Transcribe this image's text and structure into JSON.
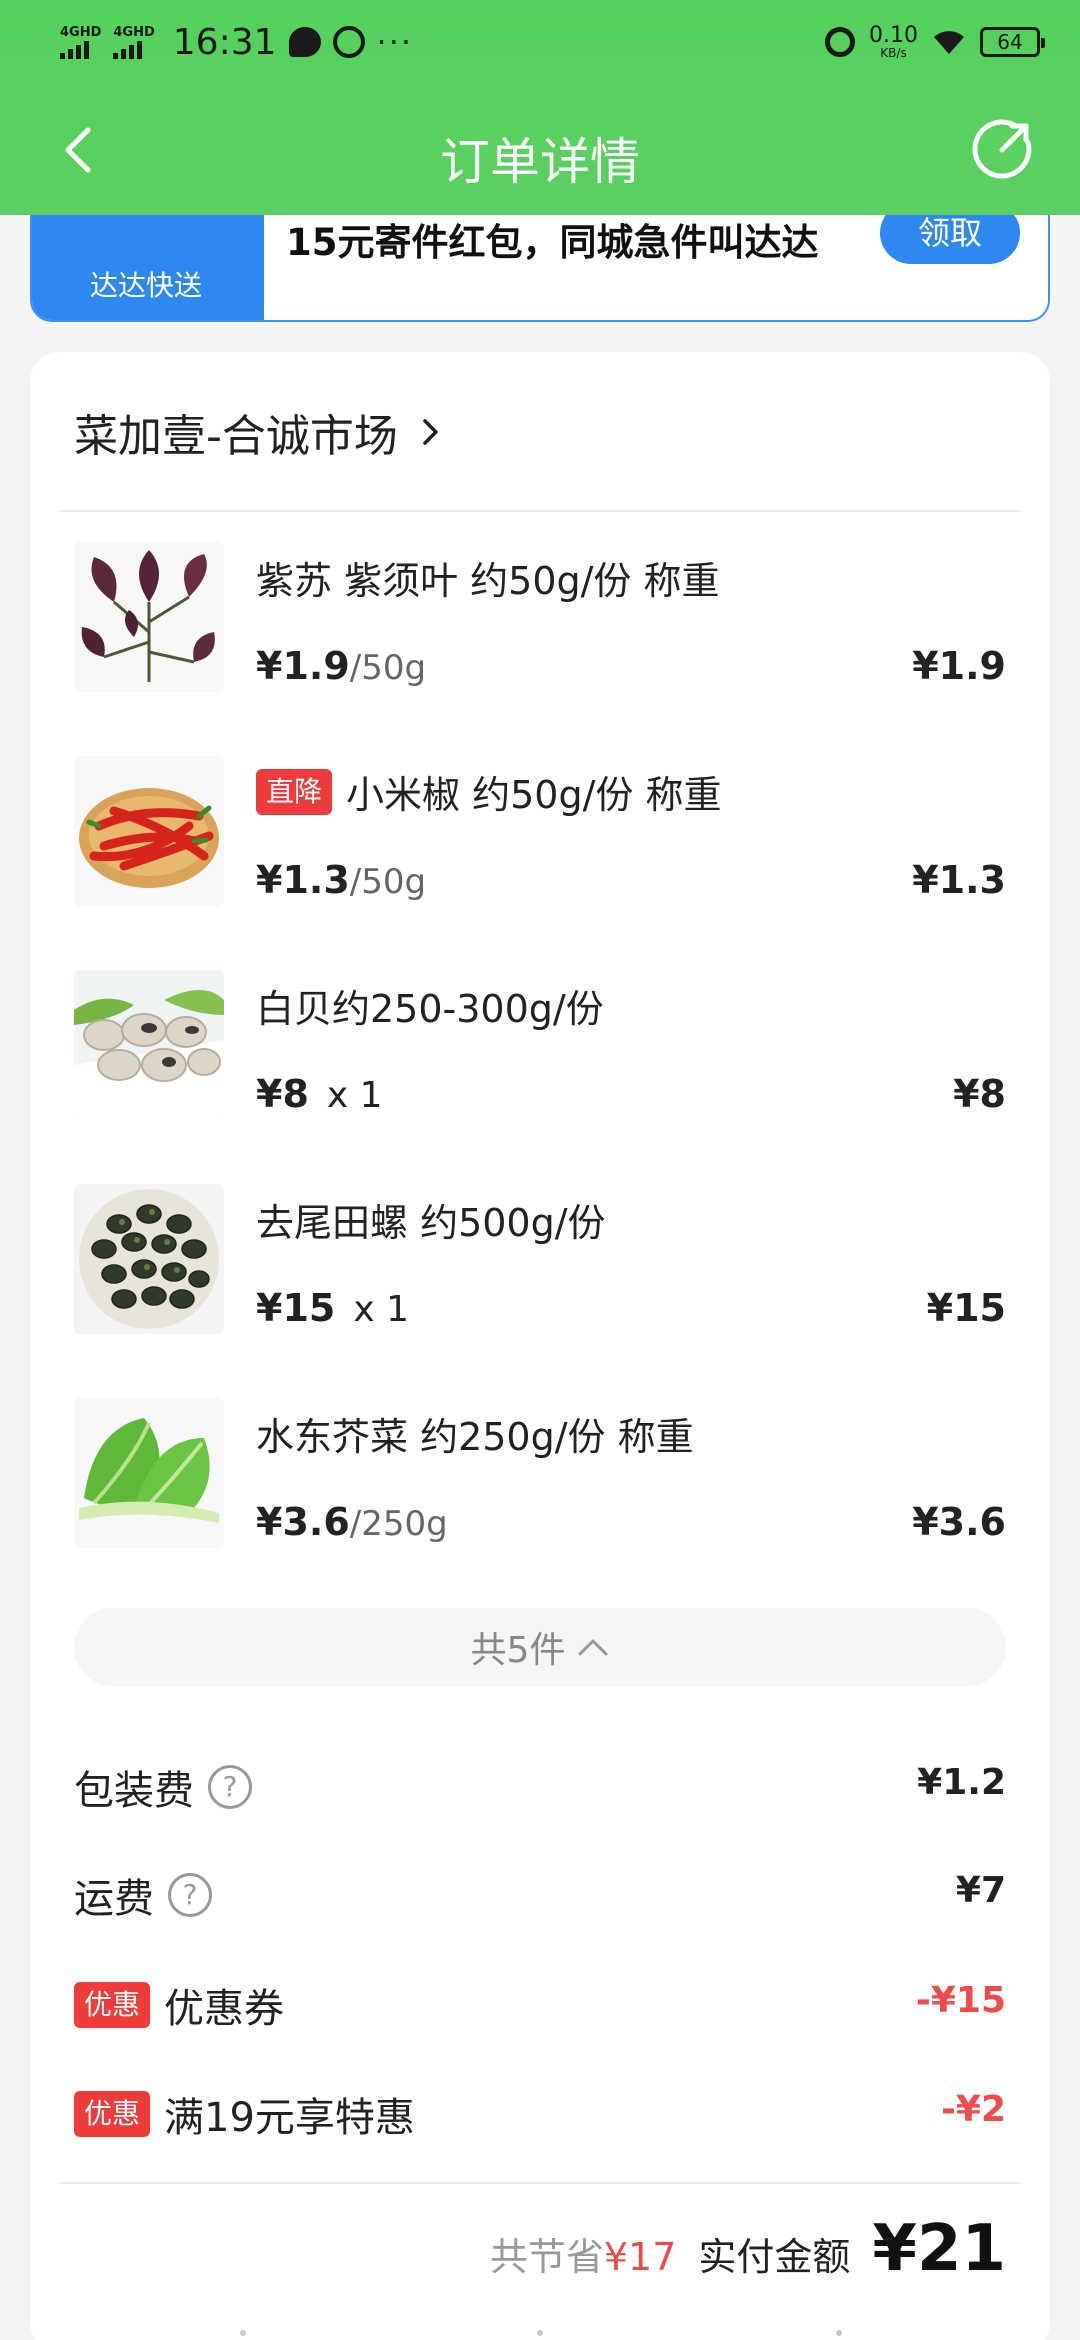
{
  "status_bar": {
    "signal1": "4GHD",
    "signal2": "4GHD",
    "time": "16:31",
    "more": "···",
    "net_speed": "0.10",
    "net_unit": "KB/s",
    "battery": "64"
  },
  "nav": {
    "title": "订单详情",
    "icons": [
      "chevron-left-icon",
      "share-icon"
    ]
  },
  "promo": {
    "amount": "15",
    "currency": "¥",
    "brand": "达达快送",
    "text": "15元寄件红包，同城急件叫达达",
    "button": "领取"
  },
  "store": {
    "name": "菜加壹-合诚市场"
  },
  "items": [
    {
      "name": "紫苏 紫须叶 约50g/份 称重",
      "tag": "",
      "price": "¥1.9",
      "unit": "/50g",
      "qty": "",
      "total": "¥1.9"
    },
    {
      "name": "小米椒  约50g/份 称重",
      "tag": "直降",
      "price": "¥1.3",
      "unit": "/50g",
      "qty": "",
      "total": "¥1.3"
    },
    {
      "name": "白贝约250-300g/份",
      "tag": "",
      "price": "¥8",
      "unit": "",
      "qty": "x  1",
      "total": "¥8"
    },
    {
      "name": "去尾田螺 约500g/份",
      "tag": "",
      "price": "¥15",
      "unit": "",
      "qty": "x  1",
      "total": "¥15"
    },
    {
      "name": "水东芥菜 约250g/份 称重",
      "tag": "",
      "price": "¥3.6",
      "unit": "/250g",
      "qty": "",
      "total": "¥3.6"
    }
  ],
  "count_label": "共5件",
  "fees": [
    {
      "label": "包装费",
      "tag": "",
      "help": true,
      "value": "¥1.2",
      "red": false
    },
    {
      "label": "运费",
      "tag": "",
      "help": true,
      "value": "¥7",
      "red": false
    },
    {
      "label": "优惠券",
      "tag": "优惠",
      "help": false,
      "value": "-¥15",
      "red": true
    },
    {
      "label": "满19元享特惠",
      "tag": "优惠",
      "help": false,
      "value": "-¥2",
      "red": true
    }
  ],
  "summary": {
    "saved_label": "共节省",
    "saved_amount": "¥17",
    "paid_label": "实付金额",
    "paid_amount": "¥21"
  },
  "colors": {
    "header_green": "#5ccf62",
    "promo_blue": "#2e88f0",
    "discount_red": "#ef4b4b",
    "tag_red": "#ee3b3b"
  }
}
